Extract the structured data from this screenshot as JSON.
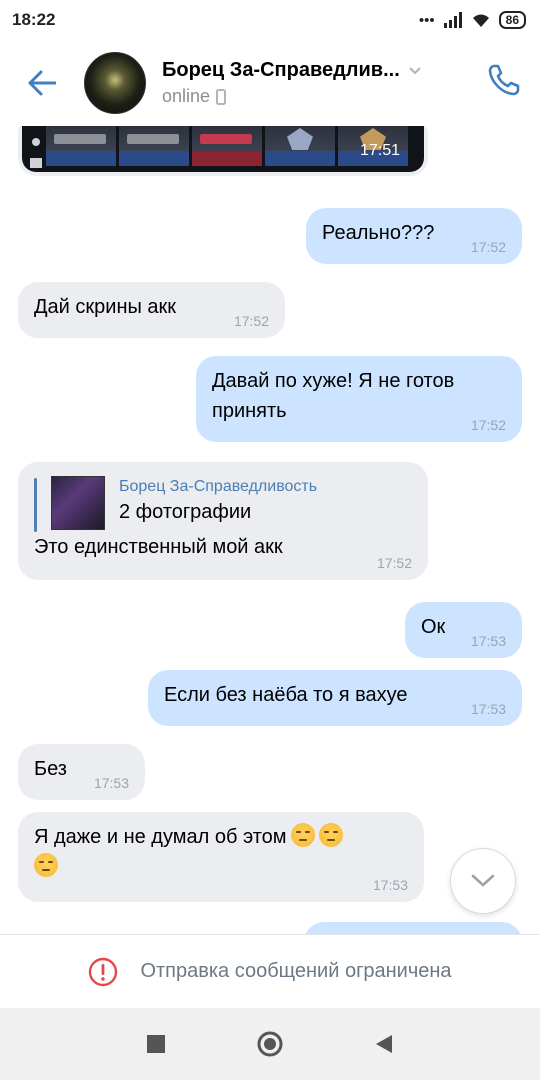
{
  "status_bar": {
    "time": "18:22",
    "signal_dots": "•••",
    "battery": "86"
  },
  "header": {
    "contact_name": "Борец За-Справедлив...",
    "status": "online"
  },
  "photo": {
    "time": "17:51"
  },
  "messages": [
    {
      "side": "out",
      "text": "Реально???",
      "time": "17:52"
    },
    {
      "side": "in",
      "text": "Дай скрины акк",
      "time": "17:52"
    },
    {
      "side": "out",
      "line1": "Давай по хуже! Я не готов",
      "line2": "принять",
      "time": "17:52"
    },
    {
      "side": "in",
      "reply_author": "Борец За-Справедливость",
      "reply_text": "2 фотографии",
      "text": "Это единственный мой акк",
      "time": "17:52"
    },
    {
      "side": "out",
      "text": "Ок",
      "time": "17:53"
    },
    {
      "side": "out",
      "text": "Если без наёба то я вахуе",
      "time": "17:53"
    },
    {
      "side": "in",
      "text": "Без",
      "time": "17:53"
    },
    {
      "side": "in",
      "text": "Я даже и не думал об этом",
      "time": "17:53"
    }
  ],
  "restriction": {
    "text": "Отправка сообщений ограничена"
  },
  "colors": {
    "accent": "#4a7fb5",
    "out_bubble": "#cce4ff",
    "in_bubble": "#ebedf0",
    "error": "#e64646"
  }
}
